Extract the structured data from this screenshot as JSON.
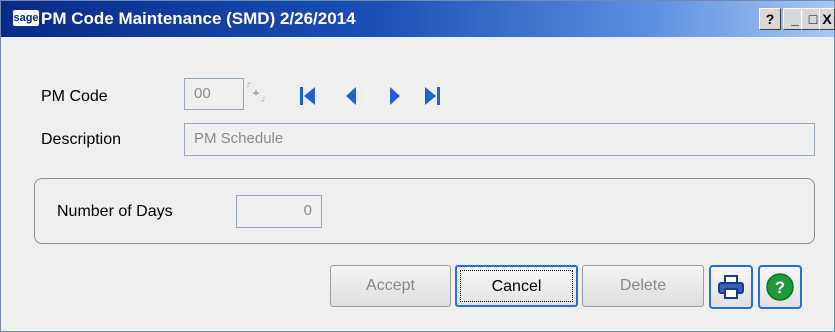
{
  "window": {
    "title": "PM Code Maintenance (SMD) 2/26/2014",
    "logo": "sage",
    "controls": {
      "help": "?",
      "minimize": "_",
      "maximize": "□",
      "close": "X"
    }
  },
  "form": {
    "pm_code_label": "PM Code",
    "pm_code_value": "00",
    "description_label": "Description",
    "description_value": "PM Schedule",
    "days_label": "Number of Days",
    "days_value": "0"
  },
  "buttons": {
    "accept": "Accept",
    "cancel": "Cancel",
    "delete": "Delete"
  },
  "icons": {
    "lookup": "lookup-icon",
    "first": "first-record-icon",
    "previous": "previous-record-icon",
    "next": "next-record-icon",
    "last": "last-record-icon",
    "print": "printer-icon",
    "help": "help-icon"
  },
  "colors": {
    "titlebar_start": "#0a2a86",
    "titlebar_end": "#a9c7f3",
    "nav_blue": "#1f5fd0",
    "focus_border": "#2a6fd0",
    "help_green": "#1e9a3a"
  }
}
